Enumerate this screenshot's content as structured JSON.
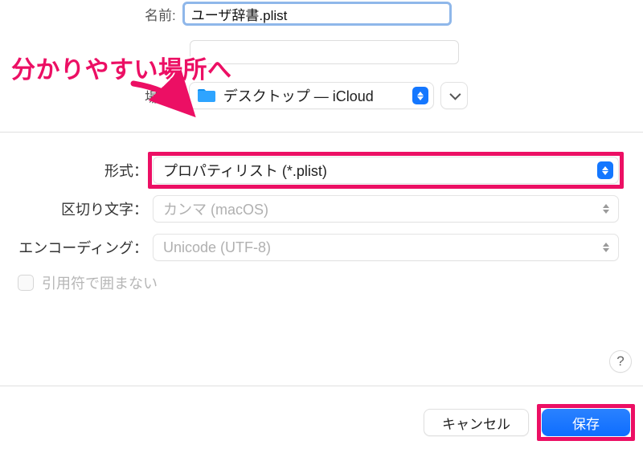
{
  "annotation": {
    "text": "分かりやすい場所へ"
  },
  "name_row": {
    "label": "名前:",
    "value": "ユーザ辞書.plist"
  },
  "location_row": {
    "label": "場所:",
    "value": "デスクトップ — iCloud"
  },
  "format_row": {
    "label": "形式：",
    "value": "プロパティリスト (*.plist)"
  },
  "delimiter_row": {
    "label": "区切り文字：",
    "value": "カンマ (macOS)"
  },
  "encoding_row": {
    "label": "エンコーディング：",
    "value": "Unicode (UTF-8)"
  },
  "quote_checkbox": {
    "label": "引用符で囲まない"
  },
  "help": {
    "label": "?"
  },
  "footer": {
    "cancel": "キャンセル",
    "save": "保存"
  }
}
